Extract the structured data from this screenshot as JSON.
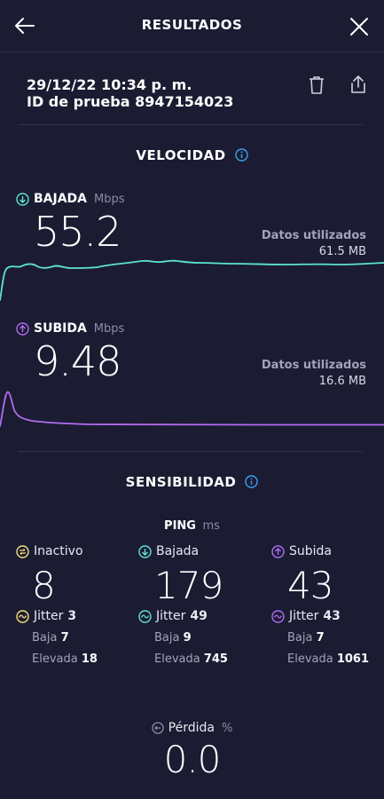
{
  "header": {
    "title": "RESULTADOS"
  },
  "test": {
    "datetime": "29/12/22 10:34 p. m.",
    "id_label": "ID de prueba",
    "id_value": "8947154023"
  },
  "speed": {
    "section_title": "VELOCIDAD",
    "download": {
      "label": "BAJADA",
      "unit": "Mbps",
      "value": "55.2",
      "data_used_label": "Datos utilizados",
      "data_used_value": "61.5 MB",
      "color": "#5ee3d2"
    },
    "upload": {
      "label": "SUBIDA",
      "unit": "Mbps",
      "value": "9.48",
      "data_used_label": "Datos utilizados",
      "data_used_value": "16.6 MB",
      "color": "#b06cf0"
    }
  },
  "sensitivity": {
    "section_title": "SENSIBILIDAD",
    "ping_label": "PING",
    "ping_unit": "ms",
    "columns": [
      {
        "label": "Inactivo",
        "value": "8",
        "jitter_label": "Jitter",
        "jitter_value": "3",
        "low_label": "Baja",
        "low_value": "7",
        "high_label": "Elevada",
        "high_value": "18",
        "color": "#f5e07a"
      },
      {
        "label": "Bajada",
        "value": "179",
        "jitter_label": "Jitter",
        "jitter_value": "49",
        "low_label": "Baja",
        "low_value": "9",
        "high_label": "Elevada",
        "high_value": "745",
        "color": "#5ee3d2"
      },
      {
        "label": "Subida",
        "value": "43",
        "jitter_label": "Jitter",
        "jitter_value": "43",
        "low_label": "Baja",
        "low_value": "7",
        "high_label": "Elevada",
        "high_value": "1061",
        "color": "#b06cf0"
      }
    ],
    "loss_label": "Pérdida",
    "loss_unit": "%",
    "loss_value": "0.0"
  },
  "colors": {
    "background": "#1b1c32",
    "info_icon": "#3aa0f0",
    "divider": "#2e3050"
  }
}
